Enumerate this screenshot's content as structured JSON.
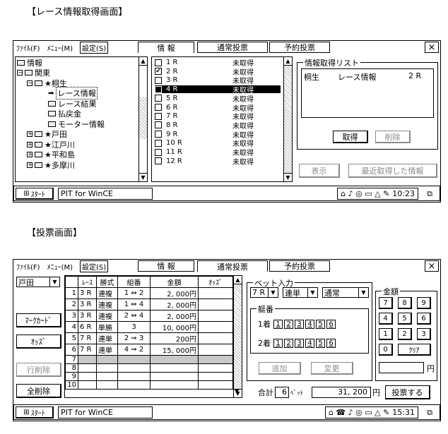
{
  "screen1": {
    "heading": "【レース情報取得画面】",
    "menu": [
      "ﾌｧｲﾙ(F)",
      "ﾒﾆｭｰ(M)",
      "設定(S)"
    ],
    "tabs": [
      "情 報",
      "通常投票",
      "予約投票"
    ],
    "close": "×",
    "tree": [
      {
        "level": 0,
        "expander": "",
        "label": "情報",
        "type": "folder"
      },
      {
        "level": 0,
        "expander": "−",
        "label": "関東",
        "type": "folder"
      },
      {
        "level": 1,
        "expander": "−",
        "label": "★桐生",
        "type": "folder"
      },
      {
        "level": 2,
        "expander": "",
        "label": "レース情報",
        "type": "arrow",
        "selected": true
      },
      {
        "level": 2,
        "expander": "",
        "label": "レース結果",
        "type": "folder"
      },
      {
        "level": 2,
        "expander": "",
        "label": "払戻金",
        "type": "folder"
      },
      {
        "level": 2,
        "expander": "",
        "label": "モーター情報",
        "type": "folder"
      },
      {
        "level": 1,
        "expander": "+",
        "label": "★戸田",
        "type": "folder"
      },
      {
        "level": 1,
        "expander": "+",
        "label": "★江戸川",
        "type": "folder"
      },
      {
        "level": 1,
        "expander": "+",
        "label": "★平和島",
        "type": "folder"
      },
      {
        "level": 1,
        "expander": "+",
        "label": "★多摩川",
        "type": "folder"
      }
    ],
    "races": [
      {
        "race": "1 R",
        "status": "未取得",
        "checked": false,
        "selected": false
      },
      {
        "race": "2 R",
        "status": "未取得",
        "checked": true,
        "selected": false
      },
      {
        "race": "3 R",
        "status": "未取得",
        "checked": false,
        "selected": false
      },
      {
        "race": "4 R",
        "status": "未取得",
        "checked": false,
        "selected": true
      },
      {
        "race": "5 R",
        "status": "未取得",
        "checked": false,
        "selected": false
      },
      {
        "race": "6 R",
        "status": "未取得",
        "checked": false,
        "selected": false
      },
      {
        "race": "7 R",
        "status": "未取得",
        "checked": false,
        "selected": false
      },
      {
        "race": "8 R",
        "status": "未取得",
        "checked": false,
        "selected": false
      },
      {
        "race": "9 R",
        "status": "未取得",
        "checked": false,
        "selected": false
      },
      {
        "race": "10 R",
        "status": "未取得",
        "checked": false,
        "selected": false
      },
      {
        "race": "11 R",
        "status": "未取得",
        "checked": false,
        "selected": false
      },
      {
        "race": "12 R",
        "status": "未取得",
        "checked": false,
        "selected": false
      }
    ],
    "list_title": "情報取得リスト",
    "list_item": {
      "venue": "桐生",
      "kind": "レース情報",
      "race": "2 R"
    },
    "btn_get": "取得",
    "btn_delete": "削除",
    "btn_show": "表示",
    "btn_recent": "最近取得した情報",
    "start": "ｽﾀｰﾄ",
    "taskitem": "PIT for WinCE",
    "time": "10:23"
  },
  "screen2": {
    "heading": "【投票画面】",
    "menu": [
      "ﾌｧｲﾙ(F)",
      "ﾒﾆｭｰ(M)",
      "設定(S)"
    ],
    "tabs": [
      "情 報",
      "通常投票",
      "予約投票"
    ],
    "close": "×",
    "venue": "戸田",
    "left_buttons": [
      "ﾏｰｸｶｰﾄﾞ",
      "ｵｯｽﾞ",
      "行削除",
      "全削除"
    ],
    "table_headers": [
      "ﾚｰｽ",
      "勝式",
      "組番",
      "金額",
      "ｵｯｽﾞ"
    ],
    "rows": [
      {
        "no": "1",
        "race": "3 R",
        "type": "連複",
        "combo": "1 ⇔ 2",
        "amount": "2, 000円"
      },
      {
        "no": "2",
        "race": "3 R",
        "type": "連複",
        "combo": "1 ⇔ 4",
        "amount": "2, 000円"
      },
      {
        "no": "3",
        "race": "3 R",
        "type": "連複",
        "combo": "2 ⇔ 4",
        "amount": "2, 000円"
      },
      {
        "no": "4",
        "race": "6 R",
        "type": "単勝",
        "combo": "3",
        "amount": "10, 000円"
      },
      {
        "no": "5",
        "race": "7 R",
        "type": "連単",
        "combo": "2 ⇒ 3",
        "amount": "200円"
      },
      {
        "no": "6",
        "race": "7 R",
        "type": "連単",
        "combo": "4 ⇒ 2",
        "amount": "15, 000円"
      },
      {
        "no": "7",
        "race": "",
        "type": "",
        "combo": "",
        "amount": ""
      },
      {
        "no": "8",
        "race": "",
        "type": "",
        "combo": "",
        "amount": ""
      },
      {
        "no": "9",
        "race": "",
        "type": "",
        "combo": "",
        "amount": ""
      },
      {
        "no": "10",
        "race": "",
        "type": "",
        "combo": "",
        "amount": ""
      }
    ],
    "bet_group": "ベット入力",
    "bet_race": "7 R",
    "bet_type": "連単",
    "bet_mode": "通常",
    "boat_group": "艇番",
    "first_label": "1着",
    "second_label": "2着",
    "boats": [
      "1",
      "2",
      "3",
      "4",
      "5",
      "6"
    ],
    "btn_add": "追加",
    "btn_change": "変更",
    "amount_group": "金額",
    "keys": [
      "7",
      "8",
      "9",
      "4",
      "5",
      "6",
      "1",
      "2",
      "3",
      "0",
      "ｸﾘｱ"
    ],
    "yen": "円",
    "total_label": "合計",
    "total_count": "6",
    "bet_unit": "ﾍﾞｯﾄ",
    "total_amount": "31, 200",
    "btn_vote": "投票する",
    "start": "ｽﾀｰﾄ",
    "taskitem": "PIT for WinCE",
    "time": "15:31"
  }
}
